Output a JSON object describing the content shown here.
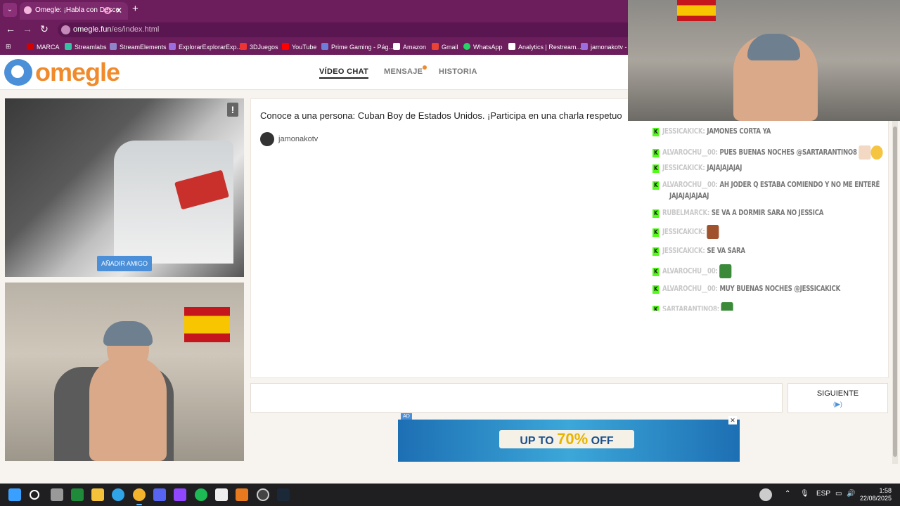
{
  "browser": {
    "tab_title": "Omegle: ¡Habla con Desco",
    "url_domain": "omegle.fun",
    "url_path": "/es/index.html",
    "bookmarks": [
      "MARCA",
      "Streamlabs",
      "StreamElements",
      "ExplorarExplorarExp...",
      "3DJuegos",
      "YouTube",
      "Prime Gaming - Pág...",
      "Amazon",
      "Gmail",
      "WhatsApp",
      "Analytics | Restream...",
      "jamonakotv - T"
    ]
  },
  "header": {
    "logo": "omegle",
    "nav": [
      "VÍDEO CHAT",
      "MENSAJE",
      "HISTORIA"
    ]
  },
  "video": {
    "add_friend": "AÑADIR AMIGO",
    "report": "!"
  },
  "chat": {
    "intro": "Conoce a una persona: Cuban Boy de Estados Unidos. ¡Participa en una charla respetuo",
    "streamer": "jamonakotv"
  },
  "controls": {
    "next": "SIGUIENTE"
  },
  "ad": {
    "label": "AD",
    "close": "✕",
    "up_to": "UP TO",
    "percent": "70%",
    "off": "OFF"
  },
  "stream_chat": [
    {
      "user": "JESSICAKICK:",
      "msg": "JAMONES CORTA YA"
    },
    {
      "user": "ALVAROCHU__00:",
      "msg": "PUES BUENAS NOCHES @SARTARANTINO8"
    },
    {
      "user": "JESSICAKICK:",
      "msg": "JAJAJAJAJAJ"
    },
    {
      "user": "ALVAROCHU__00:",
      "msg": "AH JODER Q ESTABA COMIENDO Y NO ME ENTERÉ"
    },
    {
      "user": "",
      "msg": "JAJAJAJAJAAJ"
    },
    {
      "user": "RUBELMARCK:",
      "msg": "SE VA A DORMIR SARA NO JESSICA"
    },
    {
      "user": "JESSICAKICK:",
      "msg": ""
    },
    {
      "user": "JESSICAKICK:",
      "msg": "SE VA SARA"
    },
    {
      "user": "ALVAROCHU__00:",
      "msg": ""
    },
    {
      "user": "ALVAROCHU__00:",
      "msg": "MUY BUENAS NOCHES @JESSICAKICK"
    },
    {
      "user": "SARTARANTINO8:",
      "msg": ""
    }
  ],
  "taskbar": {
    "lang": "ESP",
    "time": "1:58",
    "date": "22/08/2025"
  }
}
